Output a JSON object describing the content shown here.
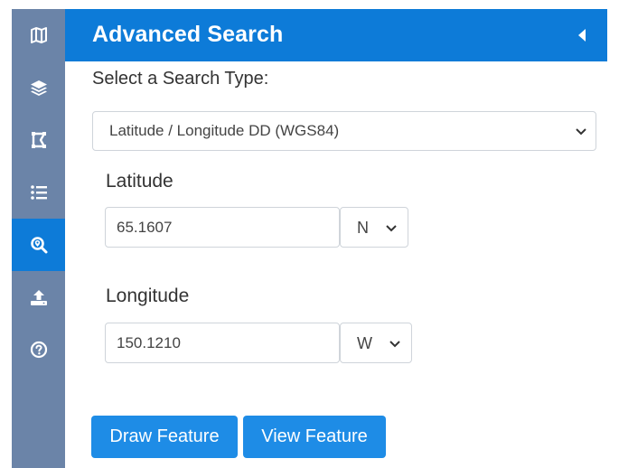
{
  "rail": {
    "items": [
      {
        "icon": "map-icon",
        "active": false
      },
      {
        "icon": "layers-icon",
        "active": false
      },
      {
        "icon": "draw-polygon-icon",
        "active": false
      },
      {
        "icon": "list-icon",
        "active": false
      },
      {
        "icon": "search-location-icon",
        "active": true
      },
      {
        "icon": "upload-icon",
        "active": false
      },
      {
        "icon": "help-icon",
        "active": false
      }
    ],
    "background": "#6b84a8",
    "active_color": "#0d7bd8"
  },
  "panel": {
    "title": "Advanced Search",
    "header_color": "#0d7bd8",
    "search_type_label": "Select a Search Type:",
    "search_type_value": "Latitude / Longitude DD (WGS84)",
    "latitude": {
      "label": "Latitude",
      "value": "65.1607",
      "hemisphere": "N"
    },
    "longitude": {
      "label": "Longitude",
      "value": "150.1210",
      "hemisphere": "W"
    },
    "buttons": {
      "draw": "Draw Feature",
      "view": "View Feature"
    },
    "button_color": "#1e8ce6"
  }
}
